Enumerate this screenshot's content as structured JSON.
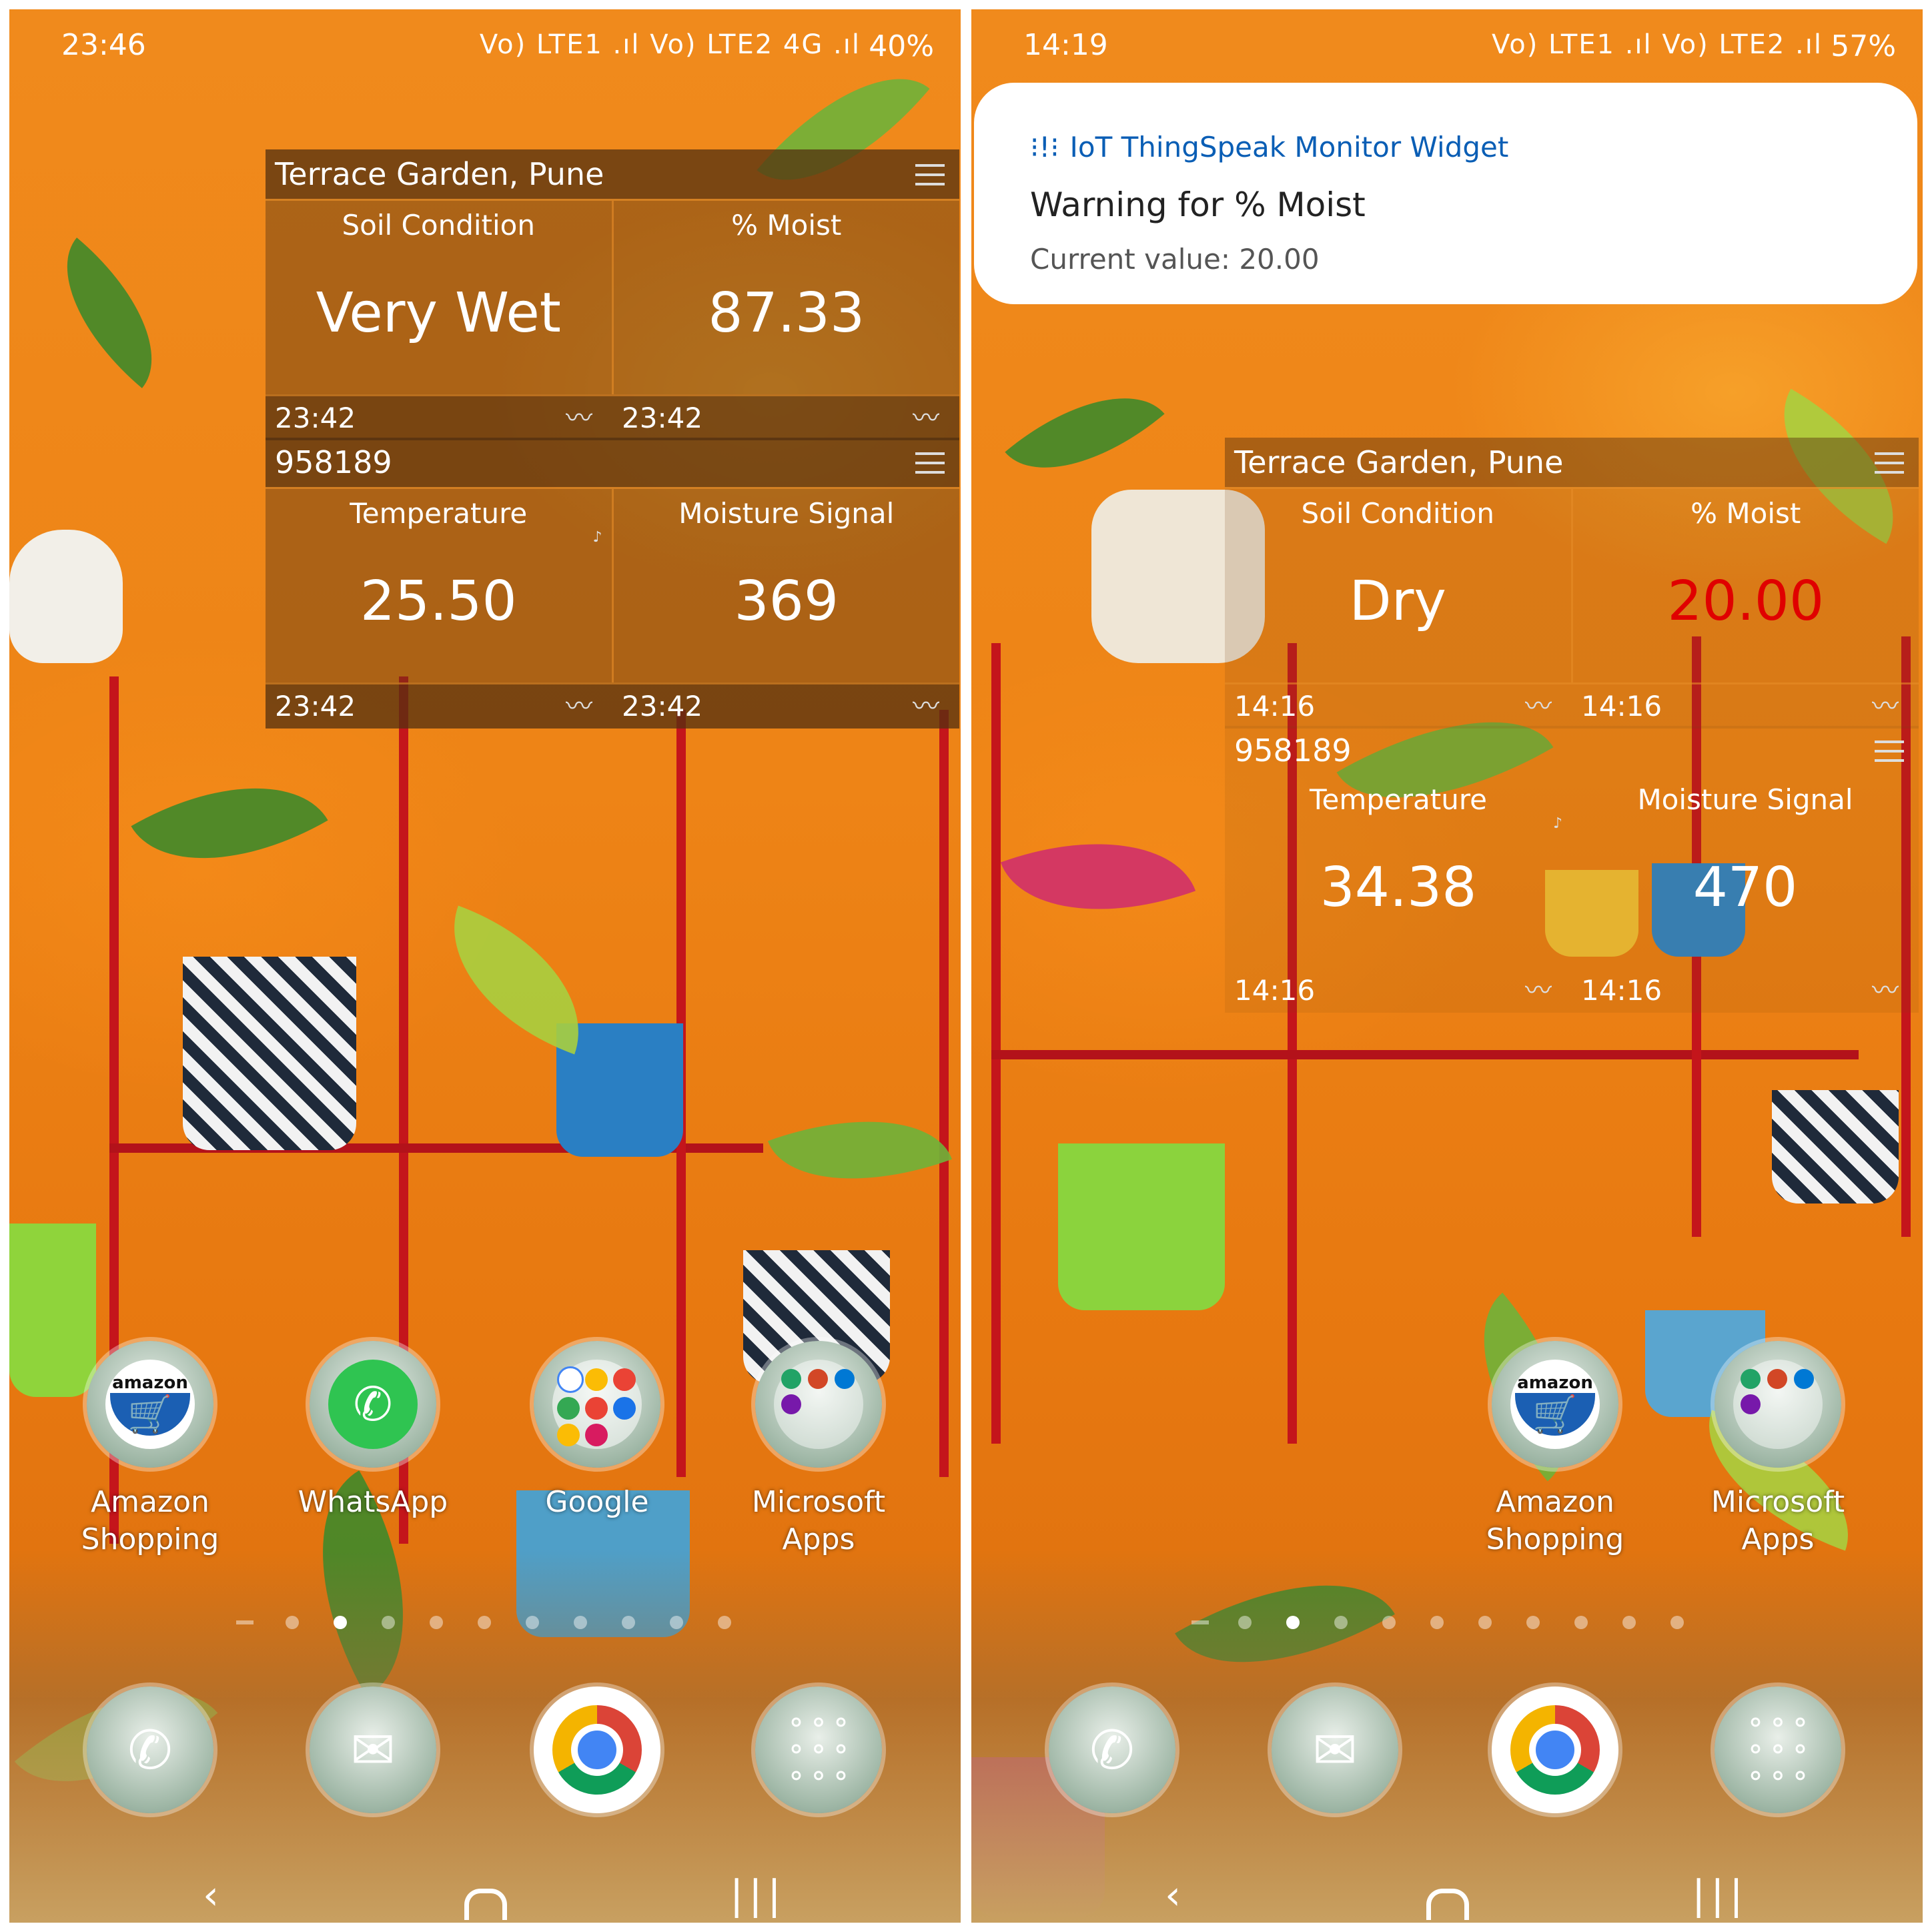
{
  "left_screen": {
    "status_bar": {
      "time": "23:46",
      "signal_icons": "Vo) LTE1 .ıl Vo) LTE2 4G .ıl",
      "battery": "40%"
    },
    "widget_top": {
      "title": "Terrace Garden, Pune",
      "cells": [
        {
          "label": "Soil Condition",
          "value": "Very Wet"
        },
        {
          "label": "% Moist",
          "value": "87.33"
        }
      ],
      "footer": [
        "23:42",
        "23:42"
      ]
    },
    "widget_bottom": {
      "title": "958189",
      "cells": [
        {
          "label": "Temperature",
          "value": "25.50"
        },
        {
          "label": "Moisture Signal",
          "value": "369"
        }
      ],
      "footer": [
        "23:42",
        "23:42"
      ]
    },
    "apps": [
      {
        "label1": "Amazon",
        "label2": "Shopping"
      },
      {
        "label1": "WhatsApp",
        "label2": ""
      },
      {
        "label1": "Google",
        "label2": ""
      },
      {
        "label1": "Microsoft",
        "label2": "Apps"
      }
    ]
  },
  "right_screen": {
    "status_bar": {
      "time": "14:19",
      "signal_icons": "Vo) LTE1 .ıl Vo) LTE2 .ıl",
      "battery": "57%"
    },
    "notification": {
      "app_name": "IoT ThingSpeak Monitor Widget",
      "title": "Warning for % Moist",
      "text": "Current value: 20.00"
    },
    "widget_top": {
      "title": "Terrace Garden, Pune",
      "cells": [
        {
          "label": "Soil Condition",
          "value": "Dry"
        },
        {
          "label": "% Moist",
          "value": "20.00"
        }
      ],
      "footer": [
        "14:16",
        "14:16"
      ]
    },
    "widget_bottom": {
      "title": "958189",
      "cells": [
        {
          "label": "Temperature",
          "value": "34.38"
        },
        {
          "label": "Moisture Signal",
          "value": "470"
        }
      ],
      "footer": [
        "14:16",
        "14:16"
      ]
    },
    "apps": [
      {
        "label1": "Amazon",
        "label2": "Shopping"
      },
      {
        "label1": "Microsoft",
        "label2": "Apps"
      }
    ]
  },
  "colors": {
    "alert_value": "#e00000",
    "notification_app": "#0a5eb5",
    "rack": "#c4151b",
    "wall": "#ee8416"
  },
  "icons": {
    "amazon": "shopping-cart-icon",
    "whatsapp": "whatsapp-icon",
    "google_folder": "google-apps-folder-icon",
    "microsoft_folder": "microsoft-apps-folder-icon",
    "phone": "phone-icon",
    "messages": "envelope-icon",
    "chrome": "chrome-icon",
    "app_drawer": "app-drawer-icon"
  }
}
